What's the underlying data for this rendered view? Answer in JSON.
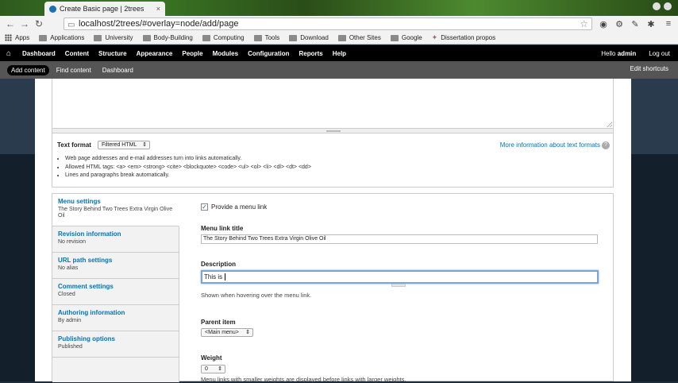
{
  "browser": {
    "tab_title": "Create Basic page | 2trees",
    "tab_close": "×",
    "url": "localhost/2trees/#overlay=node/add/page"
  },
  "bookmarks": [
    "Apps",
    "Applications",
    "University",
    "Body-Building",
    "Computing",
    "Tools",
    "Download",
    "Other Sites",
    "Google",
    "Dissertation propos"
  ],
  "admin_toolbar": {
    "items": [
      "Dashboard",
      "Content",
      "Structure",
      "Appearance",
      "People",
      "Modules",
      "Configuration",
      "Reports",
      "Help"
    ],
    "greeting": "Hello",
    "username": "admin",
    "logout": "Log out"
  },
  "shortcuts": {
    "items": [
      "Add content",
      "Find content",
      "Dashboard"
    ],
    "edit": "Edit shortcuts"
  },
  "text_format": {
    "label": "Text format",
    "selected": "Filtered HTML",
    "more_info": "More information about text formats",
    "help": "?",
    "tips": [
      "Web page addresses and e-mail addresses turn into links automatically.",
      "Allowed HTML tags: <a> <em> <strong> <cite> <blockquote> <code> <ul> <ol> <li> <dl> <dt> <dd>",
      "Lines and paragraphs break automatically."
    ]
  },
  "vertical_tabs": [
    {
      "title": "Menu settings",
      "summary": "The Story Behind Two Trees Extra Virgin Olive Oil"
    },
    {
      "title": "Revision information",
      "summary": "No revision"
    },
    {
      "title": "URL path settings",
      "summary": "No alias"
    },
    {
      "title": "Comment settings",
      "summary": "Closed"
    },
    {
      "title": "Authoring information",
      "summary": "By admin"
    },
    {
      "title": "Publishing options",
      "summary": "Published"
    }
  ],
  "menu_settings": {
    "provide_link": "Provide a menu link",
    "provide_link_mark": "✓",
    "link_title_label": "Menu link title",
    "link_title_value": "The Story Behind Two Trees Extra Virgin Olive Oil",
    "description_label": "Description",
    "description_value": "This is ",
    "description_help": "Shown when hovering over the menu link.",
    "parent_label": "Parent item",
    "parent_value": "<Main menu>",
    "weight_label": "Weight",
    "weight_value": "0",
    "weight_help": "Menu links with smaller weights are displayed before links with larger weights."
  }
}
